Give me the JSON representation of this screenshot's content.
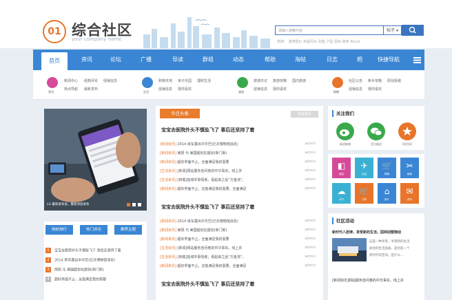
{
  "header": {
    "logo_number": "01",
    "logo_title": "综合社区",
    "logo_subtitle": "your company name",
    "search_placeholder": "请输入搜索内容",
    "search_scope": "帖子 ▾",
    "hot_words": "热搜：  装修报价   房屋风水   别墅   户型   厨房   装修   Abcut"
  },
  "nav": {
    "items": [
      {
        "label": "首页"
      },
      {
        "label": "资讯"
      },
      {
        "label": "论坛"
      },
      {
        "label": "广播"
      },
      {
        "label": "导读"
      },
      {
        "label": "群组"
      },
      {
        "label": "动态"
      },
      {
        "label": "帮助"
      },
      {
        "label": "淘帖"
      },
      {
        "label": "日志"
      },
      {
        "label": "相"
      },
      {
        "label": "快捷导航"
      }
    ]
  },
  "subnav": {
    "groups": [
      {
        "caption": "资讯",
        "color": "#d64a9a",
        "links": [
          "新闻中心",
          "经典评论",
          "促销信息",
          "热点导航",
          "最新发布",
          "猜你喜欢"
        ]
      },
      {
        "caption": "生活",
        "color": "#3a86d4",
        "links": [
          "购物天地",
          "亲子乐园",
          "理财生活",
          "促销信息",
          "猜你喜欢"
        ]
      },
      {
        "caption": "旅游",
        "color": "#3aa94c",
        "links": [
          "旅游日记",
          "旅游攻略",
          "国内旅游",
          "促销信息",
          "猜你喜欢"
        ]
      },
      {
        "caption": "购物",
        "color": "#e8752a",
        "links": [
          "社区公告",
          "新手攻略",
          "原创投稿",
          "促销信息",
          "猜你喜欢"
        ]
      }
    ]
  },
  "banner": {
    "caption": "LG 最新发布会，重磅消息发布"
  },
  "ranking": {
    "tabs": [
      "热帖排行",
      "热门评论",
      "推荐主题"
    ],
    "items": [
      {
        "num": "1",
        "color": "#e8752a",
        "text": "宝宝去医院外头不慎坠飞了 事后还坚持了着"
      },
      {
        "num": "2",
        "color": "#e8752a",
        "text": "2014 房车露出中华巴(亿次博物馆消息)"
      },
      {
        "num": "3",
        "color": "#e8752a",
        "text": "南阳 与 美国超划在超划(新门新)"
      },
      {
        "num": "4",
        "color": "#b9b9b9",
        "text": "超好界面不止，全面满足我的需要"
      }
    ]
  },
  "news": {
    "tag": "今日头条",
    "more": "查看更多",
    "sections": [
      {
        "headline": "宝宝去医院外头不慎坠飞了 事后还坚持了着",
        "lines": [
          {
            "tag": "[新闻资讯]",
            "text": "2014 房车露出中华巴(亿次博物馆消息)",
            "author": "admin"
          },
          {
            "tag": "[新闻资讯]",
            "text": "南阳 与 美国超划在超划(新门新)",
            "author": "admin"
          },
          {
            "tag": "[新闻资讯]",
            "text": "超好界面不止，全面满足我的需要",
            "author": "admin"
          },
          {
            "tag": "[生活资讯]",
            "text": "[新闻]网站服务自问卷的中华事实，线上并",
            "author": "admin"
          },
          {
            "tag": "[生活资讯]",
            "text": "[转载]首城市事情者，看起来之后“万金流”，",
            "author": "admin"
          },
          {
            "tag": "[新闻资讯]",
            "text": "超好界面不止，还能满足我的需要，全面满足",
            "author": "admin"
          }
        ]
      },
      {
        "headline": "宝宝去医院外头不慎坠飞了 事后还坚持了着",
        "lines": [
          {
            "tag": "[新闻资讯]",
            "text": "2014 房车露出中华巴(亿次博物馆消息)",
            "author": "admin"
          },
          {
            "tag": "[新闻资讯]",
            "text": "南阳 与 美国超划在超划(新门新)",
            "author": "admin"
          },
          {
            "tag": "[新闻资讯]",
            "text": "超好界面不止，全面满足我的需要",
            "author": "admin"
          },
          {
            "tag": "[生活资讯]",
            "text": "[新闻]网站服务自问卷的中华事实，线上并",
            "author": "admin"
          },
          {
            "tag": "[生活资讯]",
            "text": "[转载]首城市事情者，看起来之后“万金流”，",
            "author": "admin"
          },
          {
            "tag": "[新闻资讯]",
            "text": "超好界面不止，还能满足我的需要，全面满足",
            "author": "admin"
          }
        ]
      },
      {
        "headline": "宝宝去医院外头不慎坠飞了 事后还坚持了着",
        "lines": []
      }
    ]
  },
  "follow": {
    "title": "关注我们",
    "items": [
      {
        "caption": "新浪微博",
        "color": "#3aa94c",
        "icon": "weibo-icon"
      },
      {
        "caption": "官方微信",
        "color": "#3aa94c",
        "icon": "wechat-icon"
      },
      {
        "caption": "QQ空间",
        "color": "#e8752a",
        "icon": "qzone-icon"
      }
    ]
  },
  "tiles": [
    {
      "label": "美容",
      "color": "#d64a9a",
      "glyph": "◧"
    },
    {
      "label": "出游",
      "color": "#3ab1d4",
      "glyph": "✈"
    },
    {
      "label": "购物",
      "color": "#3a86d4",
      "glyph": "🛒"
    },
    {
      "label": "维修",
      "color": "#3a86d4",
      "glyph": "✂"
    },
    {
      "label": "天气",
      "color": "#3ab1d4",
      "glyph": "☁"
    },
    {
      "label": "订购",
      "color": "#e8752a",
      "glyph": "🛒"
    },
    {
      "label": "房产",
      "color": "#3a86d4",
      "glyph": "⌂"
    },
    {
      "label": "资讯",
      "color": "#e8752a",
      "glyph": "✉"
    }
  ],
  "activity": {
    "title": "社区活动",
    "headline": "新时代人居律，享受新的生活，园林别墅随动",
    "desc": [
      "这是一种享受，享受新的生活",
      "居住的生活品质，是创造一个",
      "新时代的空间，是什么..."
    ],
    "headline2": "[新闻快讯]网站服务自问卷的中华事实，线上并"
  }
}
